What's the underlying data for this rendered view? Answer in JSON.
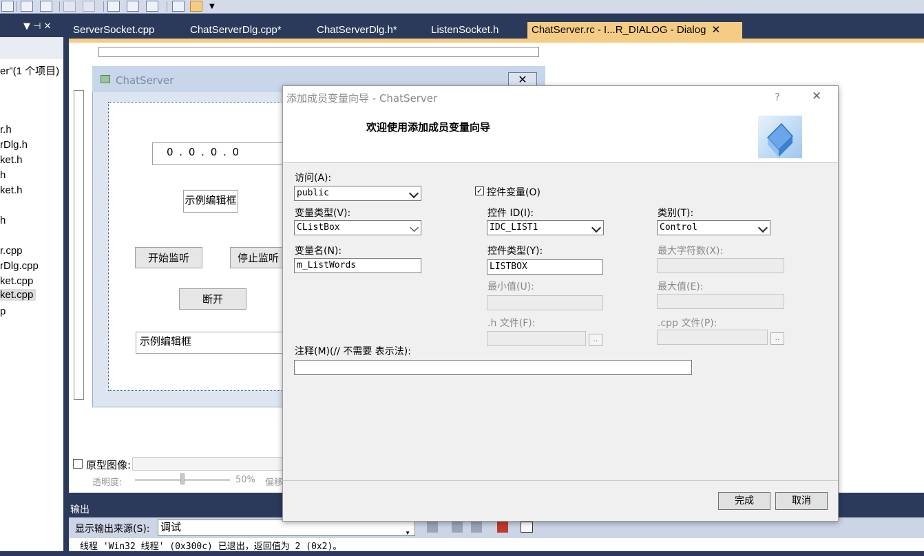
{
  "tabs": [
    "ServerSocket.cpp",
    "ChatServerDlg.cpp*",
    "ChatServerDlg.h*",
    "ListenSocket.h",
    "ChatServer.rc - I...R_DIALOG - Dialog"
  ],
  "solution": {
    "header_pin": "▼ ⊣ ✕",
    "items": [
      "er\"(1 个项目)",
      "r.h",
      "rDlg.h",
      "ket.h",
      "h",
      "ket.h",
      "h",
      "r.cpp",
      "rDlg.cpp",
      "ket.cpp",
      "ket.cpp",
      "p"
    ]
  },
  "mock_dialog": {
    "title": "ChatServer",
    "ip_text": "0 . 0 . 0 . 0",
    "edit_sample1": "示例编辑框",
    "btn_start": "开始监听",
    "btn_stop": "停止监听",
    "btn_disconnect": "断开",
    "edit_sample2": "示例编辑框"
  },
  "proto": {
    "checkbox_label": "原型图像:",
    "opacity_label": "透明度:",
    "opacity_value": "50%",
    "offset_label": "偏移"
  },
  "output": {
    "title": "输出",
    "source_label": "显示输出来源(S):",
    "source_value": "调试",
    "log_line": "线程 'Win32 线程' (0x300c) 已退出，返回值为 2 (0x2)。"
  },
  "wizard": {
    "title": "添加成员变量向导 - ChatServer",
    "help": "?",
    "close": "✕",
    "heading": "欢迎使用添加成员变量向导",
    "access_label": "访问(A):",
    "access_value": "public",
    "control_var_label": "控件变量(O)",
    "control_var_checked": true,
    "var_type_label": "变量类型(V):",
    "var_type_value": "CListBox",
    "control_id_label": "控件 ID(I):",
    "control_id_value": "IDC_LIST1",
    "category_label": "类别(T):",
    "category_value": "Control",
    "var_name_label": "变量名(N):",
    "var_name_value": "m_ListWords",
    "control_type_label": "控件类型(Y):",
    "control_type_value": "LISTBOX",
    "max_chars_label": "最大字符数(X):",
    "min_label": "最小值(U):",
    "max_label": "最大值(E):",
    "h_file_label": ".h 文件(F):",
    "cpp_file_label": ".cpp 文件(P):",
    "browse": "..",
    "comment_label": "注释(M)(// 不需要 表示法):",
    "comment_value": "",
    "finish": "完成",
    "cancel": "取消"
  }
}
